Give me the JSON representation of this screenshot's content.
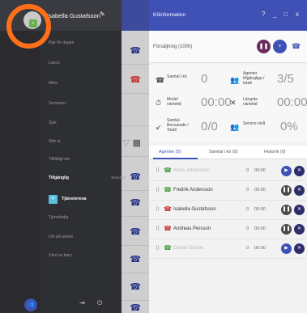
{
  "main": {
    "title": "Köinformation",
    "window_controls": [
      "?",
      "_",
      "□",
      "x"
    ],
    "queue_label": "Försäljning (1000)",
    "stats": [
      {
        "label": "Samtal i kö",
        "value": "0"
      },
      {
        "label": "Agenter tillgängliga / totalt",
        "value": "3/5"
      },
      {
        "label": "Medel väntetid",
        "value": "00:00"
      },
      {
        "label": "Längsta väntetid",
        "value": "00:00"
      },
      {
        "label": "Samtal Besvarade / Totalt",
        "value": "0/0"
      },
      {
        "label": "Service nivå",
        "value": "0%"
      }
    ],
    "tabs": [
      "Agenter (5)",
      "Samtal i kö (0)",
      "Historik (0)"
    ],
    "agents": [
      {
        "name": "Anna Johansson",
        "count": "0",
        "time": "00:00",
        "color": "#3a9b3a",
        "dim": true
      },
      {
        "name": "Fredrik Andersson",
        "count": "0",
        "time": "00:00",
        "color": "#3a9b3a",
        "dim": false
      },
      {
        "name": "Isabella Gustafsson",
        "count": "0",
        "time": "00:00",
        "color": "#c62828",
        "dim": false
      },
      {
        "name": "Andreas Persson",
        "count": "0",
        "time": "00:00",
        "color": "#c62828",
        "dim": false
      },
      {
        "name": "Daniel Olsson",
        "count": "0",
        "time": "00:00",
        "color": "#3a9b3a",
        "dim": true
      }
    ]
  },
  "drawer": {
    "profile_name": "Isabella Gustafsson",
    "items": [
      "Klar för dagen",
      "Lunch",
      "Möte",
      "Semester",
      "Sjuk",
      "Stör ej",
      "Tillfälligt ute"
    ],
    "active_item": "Tillgänglig",
    "active_suffix": "Standard",
    "teams_item": "Tjänsteresa",
    "more_items": [
      "Tjänstledig",
      "Ute på arbete",
      "Värd av barn"
    ]
  }
}
